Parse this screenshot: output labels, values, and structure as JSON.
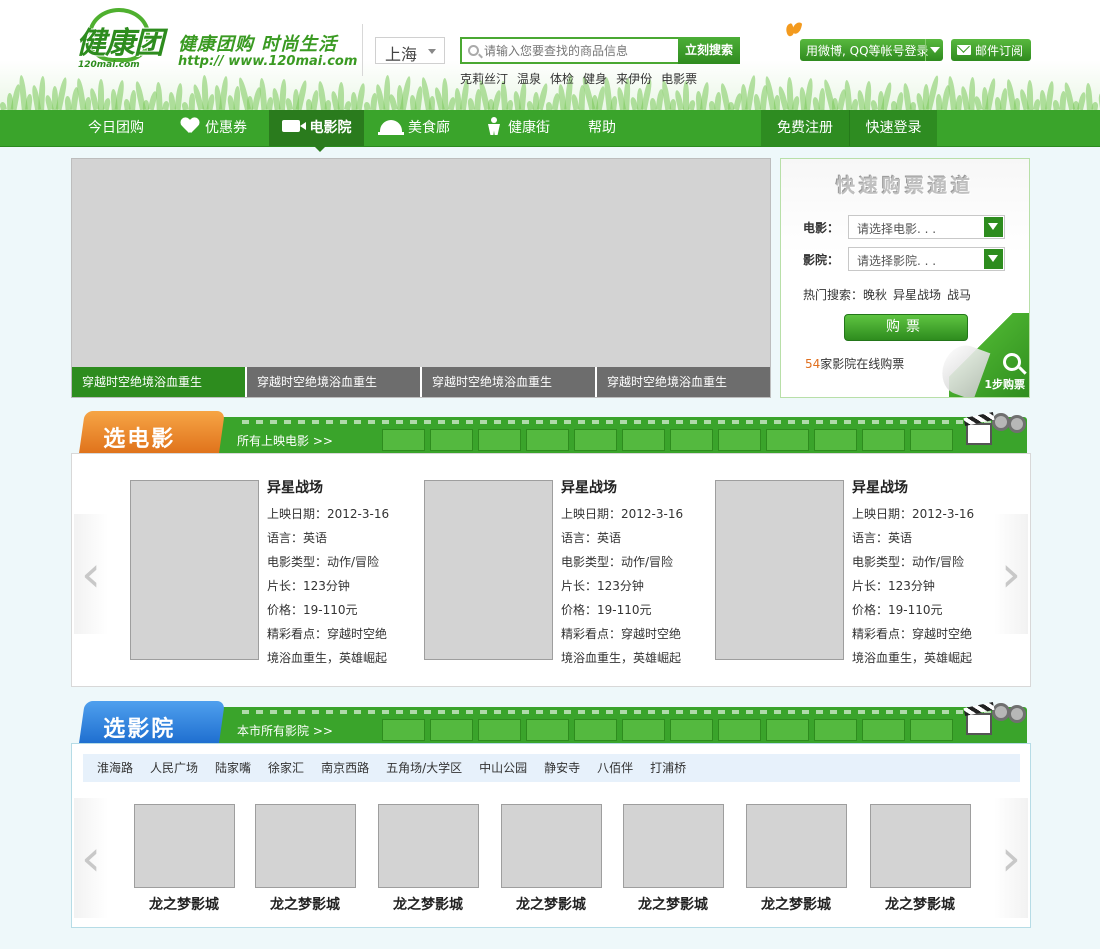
{
  "header": {
    "logo_text": "健康团",
    "logo_domain": "120mai.com",
    "slogan": "健康团购 时尚生活",
    "site_url": "http:// www.120mai.com",
    "city": "上海",
    "search_placeholder": "请输入您要查找的商品信息",
    "search_button": "立刻搜索",
    "hot_keywords": [
      "克莉丝汀",
      "温泉",
      "体检",
      "健身",
      "来伊份",
      "电影票"
    ],
    "login_label": "用微博, QQ等帐号登录",
    "subscribe_label": "邮件订阅"
  },
  "nav": {
    "items": [
      {
        "label": "今日团购",
        "icon": ""
      },
      {
        "label": "优惠券",
        "icon": "heart-icon"
      },
      {
        "label": "电影院",
        "icon": "camera-icon",
        "active": true
      },
      {
        "label": "美食廊",
        "icon": "cloche-icon"
      },
      {
        "label": "健康街",
        "icon": "fitness-icon"
      },
      {
        "label": "帮助",
        "icon": ""
      }
    ],
    "register": "免费注册",
    "login": "快速登录"
  },
  "banner": {
    "tabs": [
      "穿越时空绝境浴血重生",
      "穿越时空绝境浴血重生",
      "穿越时空绝境浴血重生",
      "穿越时空绝境浴血重生"
    ],
    "active_tab": 0
  },
  "quick_buy": {
    "title": "快速购票通道",
    "movie_label": "电影：",
    "movie_placeholder": "请选择电影. . .",
    "cinema_label": "影院：",
    "cinema_placeholder": "请选择影院. . .",
    "hot_label": "热门搜索：",
    "hot_items": [
      "晚秋",
      "异星战场",
      "战马"
    ],
    "buy_button": "购票",
    "cinema_count": "54",
    "cinema_count_suffix": "家影院在线购票",
    "step_label": "1步购票"
  },
  "movie_section": {
    "title": "选电影",
    "link": "所有上映电影 >>",
    "prev": "‹",
    "next": "›",
    "movies": [
      {
        "title": "异星战场",
        "release": "上映日期：2012-3-16",
        "language": "语言：英语",
        "genre": "电影类型：动作/冒险",
        "length": "片长：123分钟",
        "price": "价格：19-110元",
        "highlight_1": "精彩看点：穿越时空绝",
        "highlight_2": "境浴血重生，英雄崛起"
      },
      {
        "title": "异星战场",
        "release": "上映日期：2012-3-16",
        "language": "语言：英语",
        "genre": "电影类型：动作/冒险",
        "length": "片长：123分钟",
        "price": "价格：19-110元",
        "highlight_1": "精彩看点：穿越时空绝",
        "highlight_2": "境浴血重生，英雄崛起"
      },
      {
        "title": "异星战场",
        "release": "上映日期：2012-3-16",
        "language": "语言：英语",
        "genre": "电影类型：动作/冒险",
        "length": "片长：123分钟",
        "price": "价格：19-110元",
        "highlight_1": "精彩看点：穿越时空绝",
        "highlight_2": "境浴血重生，英雄崛起"
      }
    ]
  },
  "cinema_section": {
    "title": "选影院",
    "link": "本市所有影院 >>",
    "districts": [
      "淮海路",
      "人民广场",
      "陆家嘴",
      "徐家汇",
      "南京西路",
      "五角场/大学区",
      "中山公园",
      "静安寺",
      "八佰伴",
      "打浦桥"
    ],
    "prev": "‹",
    "next": "›",
    "cinemas": [
      "龙之梦影城",
      "龙之梦影城",
      "龙之梦影城",
      "龙之梦影城",
      "龙之梦影城",
      "龙之梦影城",
      "龙之梦影城"
    ]
  },
  "colors": {
    "brand_green": "#3aa42b",
    "dark_green": "#2a7b1d",
    "orange": "#e0731c",
    "blue": "#1f6fd0"
  }
}
